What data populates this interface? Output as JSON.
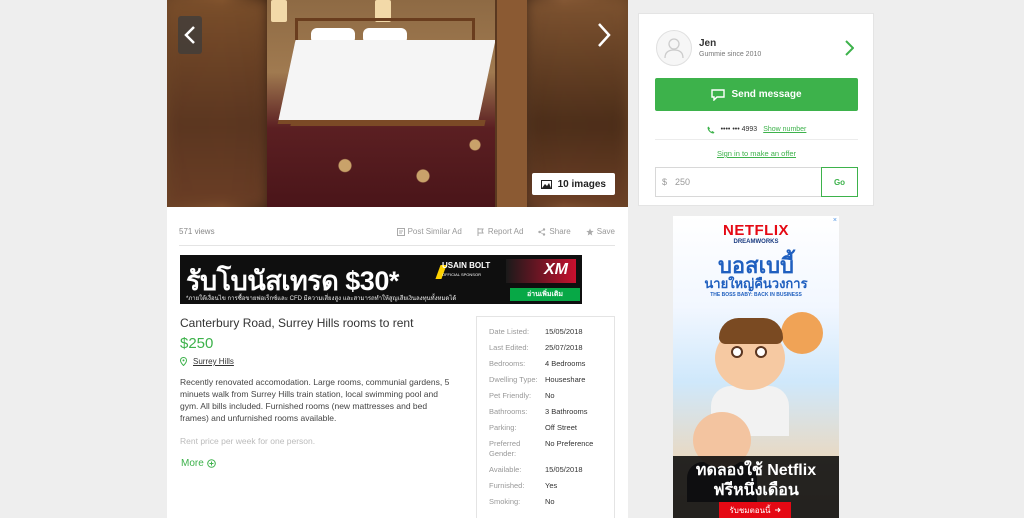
{
  "gallery": {
    "image_count_label": "10 images",
    "prev_icon": "chevron-left-icon",
    "next_icon": "chevron-right-icon"
  },
  "stats": {
    "views": "571 views",
    "actions": [
      "Post Similar Ad",
      "Report Ad",
      "Share",
      "Save"
    ]
  },
  "banner": {
    "headline": "รับโบนัสเทรด $30*",
    "fine_print": "*ภายใต้เงื่อนไข การซื้อขายฟอเร็กซ์และ CFD มีความเสี่ยงสูง และสามารถทำให้สูญเสียเงินลงทุนทั้งหมดได้",
    "sponsor_name": "USAIN BOLT",
    "sponsor_tag": "OFFICIAL SPONSOR",
    "brand": "XM",
    "brand_url": "WWW.XM.COM",
    "cta": "อ่านเพิ่มเติม"
  },
  "listing": {
    "title": "Canterbury Road, Surrey Hills rooms to rent",
    "price": "$250",
    "location": "Surrey Hills",
    "description": "Recently renovated accomodation. Large rooms, communial gardens, 5 minuets walk from Surrey Hills train station, local swimming pool and gym. All bills included. Furnished rooms (new mattresses and bed frames) and unfurnished rooms available.",
    "description_faded": "Rent price per week for one person.",
    "more_label": "More"
  },
  "details": [
    {
      "label": "Date Listed:",
      "value": "15/05/2018"
    },
    {
      "label": "Last Edited:",
      "value": "25/07/2018"
    },
    {
      "label": "Bedrooms:",
      "value": "4 Bedrooms"
    },
    {
      "label": "Dwelling Type:",
      "value": "Houseshare"
    },
    {
      "label": "Pet Friendly:",
      "value": "No"
    },
    {
      "label": "Bathrooms:",
      "value": "3 Bathrooms"
    },
    {
      "label": "Parking:",
      "value": "Off Street"
    },
    {
      "label": "Preferred Gender:",
      "value": "No Preference"
    },
    {
      "label": "Available:",
      "value": "15/05/2018"
    },
    {
      "label": "Furnished:",
      "value": "Yes"
    },
    {
      "label": "Smoking:",
      "value": "No"
    }
  ],
  "seller": {
    "name": "Jen",
    "since": "Gummie since 2010",
    "send_label": "Send message",
    "phone_masked": "•••• ••• 4993",
    "show_number_label": "Show number",
    "offer_link": "Sign in to make an offer",
    "offer_currency": "$",
    "offer_value": "250",
    "go_label": "Go"
  },
  "ad": {
    "close": "×",
    "brand": "NETFLIX",
    "studio": "DREAMWORKS",
    "title_line1": "บอสเบบี้",
    "title_line2": "นายใหญ่คืนวงการ",
    "subtitle": "THE BOSS BABY: BACK IN BUSINESS",
    "cta_line1": "ทดลองใช้ Netflix",
    "cta_line2": "ฟรีหนึ่งเดือน",
    "button": "รับชมตอนนี้"
  },
  "colors": {
    "accent_green": "#3db24b",
    "netflix_red": "#e50914"
  }
}
